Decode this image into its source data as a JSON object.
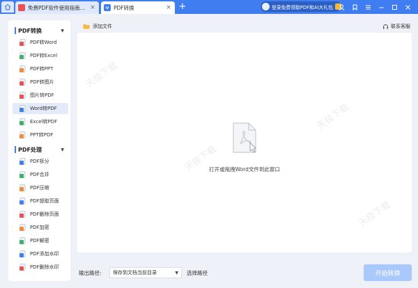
{
  "titlebar": {
    "tabs": [
      {
        "label": "免费PDF软件使用指南..."
      },
      {
        "label": "PDF转换"
      }
    ],
    "new_tab": "+",
    "close_glyph": "×",
    "promo": "登录免费领取PDF和AI大礼包",
    "window_icons": [
      "user-icon",
      "bookmark-icon",
      "menu-icon",
      "minimize-icon",
      "maximize-icon",
      "close-icon"
    ]
  },
  "sidebar": {
    "sections": [
      {
        "title": "PDF转换",
        "items": [
          {
            "label": "PDF转Word",
            "color": "#e55353"
          },
          {
            "label": "PDF转Excel",
            "color": "#3db06b"
          },
          {
            "label": "PDF转PPT",
            "color": "#f08a3c"
          },
          {
            "label": "PDF转图片",
            "color": "#e55353"
          },
          {
            "label": "图片转PDF",
            "color": "#e55353"
          },
          {
            "label": "Word转PDF",
            "color": "#3f7df0"
          },
          {
            "label": "Excel转PDF",
            "color": "#3db06b"
          },
          {
            "label": "PPT转PDF",
            "color": "#f08a3c"
          }
        ]
      },
      {
        "title": "PDF处理",
        "items": [
          {
            "label": "PDF拆分",
            "color": "#3f7df0"
          },
          {
            "label": "PDF合并",
            "color": "#3db06b"
          },
          {
            "label": "PDF压缩",
            "color": "#f08a3c"
          },
          {
            "label": "PDF提取页面",
            "color": "#3f7df0"
          },
          {
            "label": "PDF删除页面",
            "color": "#e55353"
          },
          {
            "label": "PDF加密",
            "color": "#f08a3c"
          },
          {
            "label": "PDF解密",
            "color": "#3db06b"
          },
          {
            "label": "PDF添加水印",
            "color": "#3f7df0"
          },
          {
            "label": "PDF删除水印",
            "color": "#e55353"
          }
        ]
      }
    ],
    "selected": "Word转PDF"
  },
  "toolbar": {
    "add_file": "添加文件",
    "support": "联系客服"
  },
  "dropzone": {
    "hint": "打开或拖拽Word文件到此窗口"
  },
  "bottom": {
    "output_label": "输出路径:",
    "output_value": "保存到文档当前目录",
    "choose_path": "选择路径",
    "start_button": "开始转换"
  },
  "colors": {
    "accent": "#3f7df0",
    "start_button_disabled": "#a9c8fb",
    "background": "#eef1f7"
  }
}
